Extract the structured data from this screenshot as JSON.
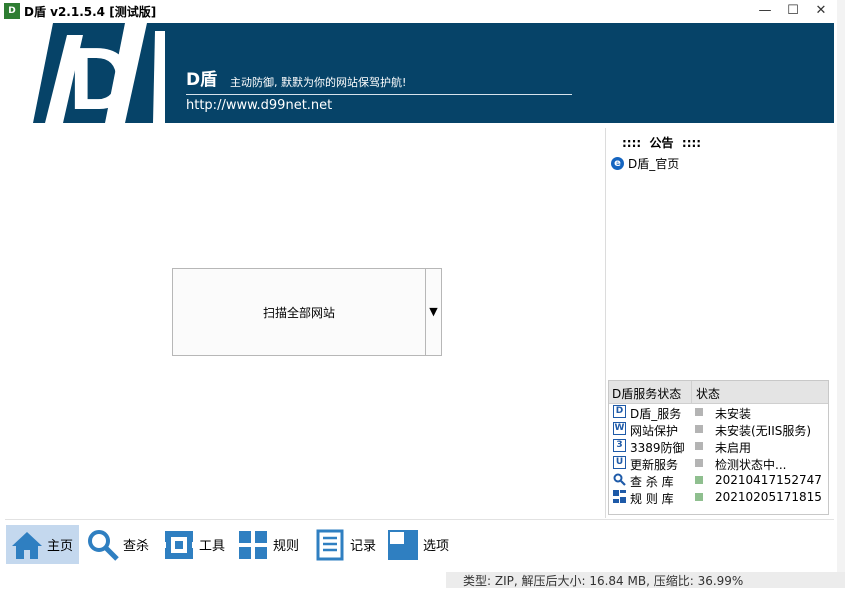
{
  "window": {
    "title": "D盾 v2.1.5.4 [测试版]",
    "icon_text": "D",
    "min_glyph": "—",
    "max_glyph": "☐",
    "close_glyph": "✕"
  },
  "banner": {
    "logo_text": "D",
    "brand": "D盾",
    "slogan": "主动防御, 默默为你的网站保驾护航!",
    "url": "http://www.d99net.net"
  },
  "main": {
    "scan_button_label": "扫描全部网站",
    "dropdown_glyph": "▼"
  },
  "notice": {
    "title": "::::  公告  ::::",
    "link_label": "D盾_官页",
    "link_icon": "ie-icon"
  },
  "status": {
    "header_service": "D盾服务状态",
    "header_state": "状态",
    "rows": [
      {
        "icon": "D",
        "name": "D盾_服务",
        "value": "未安装",
        "indicator": "#b4b4b4"
      },
      {
        "icon": "W",
        "name": "网站保护",
        "value": "未安装(无IIS服务)",
        "indicator": "#b4b4b4"
      },
      {
        "icon": "3",
        "name": "3389防御",
        "value": "未启用",
        "indicator": "#b4b4b4"
      },
      {
        "icon": "U",
        "name": "更新服务",
        "value": "检测状态中...",
        "indicator": "#b4b4b4"
      },
      {
        "icon": "search-icon",
        "name": "查 杀 库",
        "value": "20210417152747",
        "indicator": "#8fbf8f"
      },
      {
        "icon": "rules-icon",
        "name": "规 则 库",
        "value": "20210205171815",
        "indicator": "#8fbf8f"
      }
    ]
  },
  "nav": [
    {
      "label": "主页",
      "icon": "home-icon",
      "active": true
    },
    {
      "label": "查杀",
      "icon": "search-icon",
      "active": false
    },
    {
      "label": "工具",
      "icon": "tools-icon",
      "active": false
    },
    {
      "label": "规则",
      "icon": "grid-icon",
      "active": false
    },
    {
      "label": "记录",
      "icon": "list-icon",
      "active": false
    },
    {
      "label": "选项",
      "icon": "options-icon",
      "active": false
    }
  ],
  "background_window": {
    "status_text": "类型: ZIP, 解压后大小: 16.84 MB, 压缩比: 36.99%"
  },
  "colors": {
    "banner": "#064368",
    "accent": "#3b7fc4",
    "nav_active": "#c4d8ee"
  }
}
